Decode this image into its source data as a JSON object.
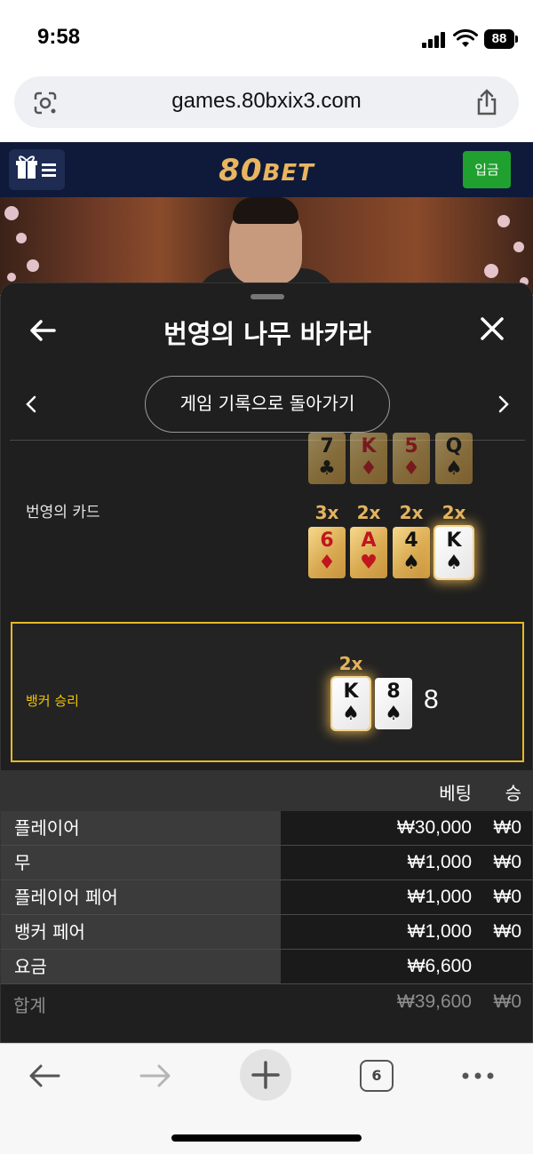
{
  "status_bar": {
    "time": "9:58",
    "battery": "88"
  },
  "browser": {
    "url": "games.80bxix3.com",
    "tab_count": "6"
  },
  "site": {
    "logo_big": "80",
    "logo_small": "BET",
    "deposit_label": "입금"
  },
  "sheet": {
    "title": "번영의 나무 바카라",
    "back_to_history": "게임 기록으로 돌아가기",
    "cards_label": "번영의 카드",
    "top_row_cards": [
      {
        "rank": "7",
        "suit": "♣",
        "color": "black"
      },
      {
        "rank": "K",
        "suit": "♦",
        "color": "red"
      },
      {
        "rank": "5",
        "suit": "♦",
        "color": "red"
      },
      {
        "rank": "Q",
        "suit": "♠",
        "color": "black"
      }
    ],
    "prosperity_cards": [
      {
        "mult": "3x",
        "rank": "6",
        "suit": "♦",
        "color": "red"
      },
      {
        "mult": "2x",
        "rank": "A",
        "suit": "♥",
        "color": "red"
      },
      {
        "mult": "2x",
        "rank": "4",
        "suit": "♠",
        "color": "black"
      },
      {
        "mult": "2x",
        "rank": "K",
        "suit": "♠",
        "color": "black"
      }
    ],
    "result": {
      "label": "뱅커 승리",
      "mult": "2x",
      "cards": [
        {
          "rank": "K",
          "suit": "♠"
        },
        {
          "rank": "8",
          "suit": "♠"
        }
      ],
      "score": "8"
    },
    "table": {
      "col_bet": "베팅",
      "col_win": "승",
      "rows": [
        {
          "name": "플레이어",
          "bet": "₩30,000",
          "win": "₩0"
        },
        {
          "name": "무",
          "bet": "₩1,000",
          "win": "₩0"
        },
        {
          "name": "플레이어 페어",
          "bet": "₩1,000",
          "win": "₩0"
        },
        {
          "name": "뱅커 페어",
          "bet": "₩1,000",
          "win": "₩0"
        },
        {
          "name": "요금",
          "bet": "₩6,600",
          "win": ""
        }
      ],
      "total": {
        "name": "합계",
        "bet": "₩39,600",
        "win": "₩0"
      }
    }
  }
}
